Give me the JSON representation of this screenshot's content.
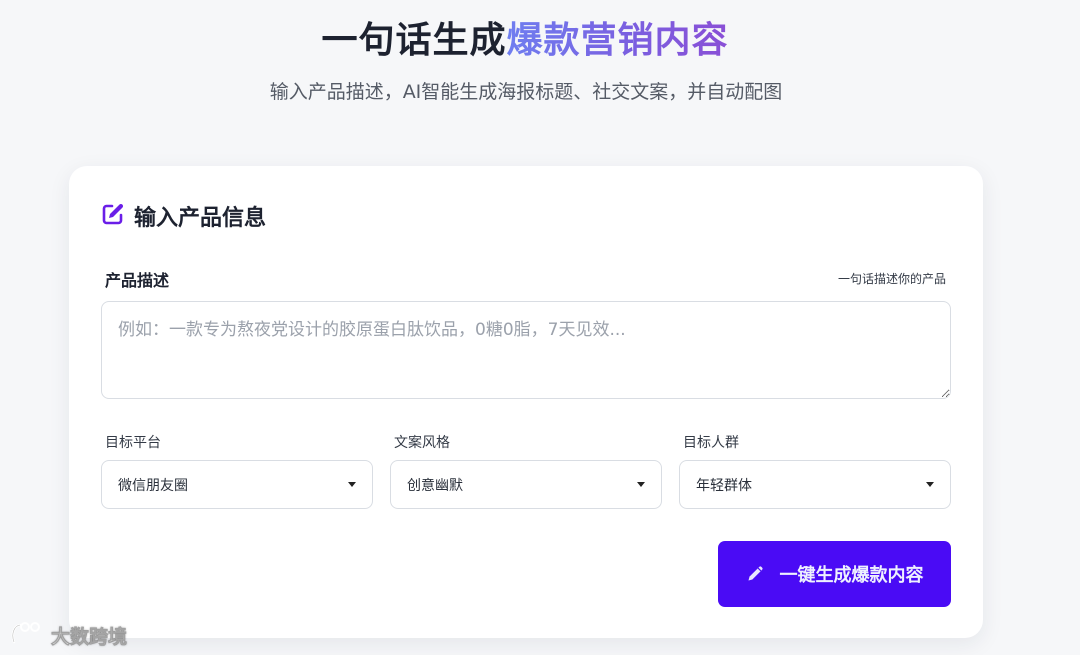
{
  "hero": {
    "title_plain": "一句话生成",
    "title_highlight": "爆款营销内容",
    "subtitle": "输入产品描述，AI智能生成海报标题、社交文案，并自动配图"
  },
  "card": {
    "title": "输入产品信息",
    "icon": "edit-icon",
    "description": {
      "label": "产品描述",
      "hint": "一句话描述你的产品",
      "placeholder": "例如：一款专为熬夜党设计的胶原蛋白肽饮品，0糖0脂，7天见效...",
      "value": ""
    },
    "fields": [
      {
        "label": "目标平台",
        "selected": "微信朋友圈"
      },
      {
        "label": "文案风格",
        "selected": "创意幽默"
      },
      {
        "label": "目标人群",
        "selected": "年轻群体"
      }
    ],
    "generate_button": {
      "label": "一键生成爆款内容",
      "icon": "pencil-icon"
    }
  },
  "watermark": {
    "text": "大数跨境"
  },
  "colors": {
    "accent": "#4a0bf5",
    "title_gradient_start": "#6f7ef0",
    "title_gradient_end": "#8a4fd6",
    "background": "#f6f7f9"
  }
}
